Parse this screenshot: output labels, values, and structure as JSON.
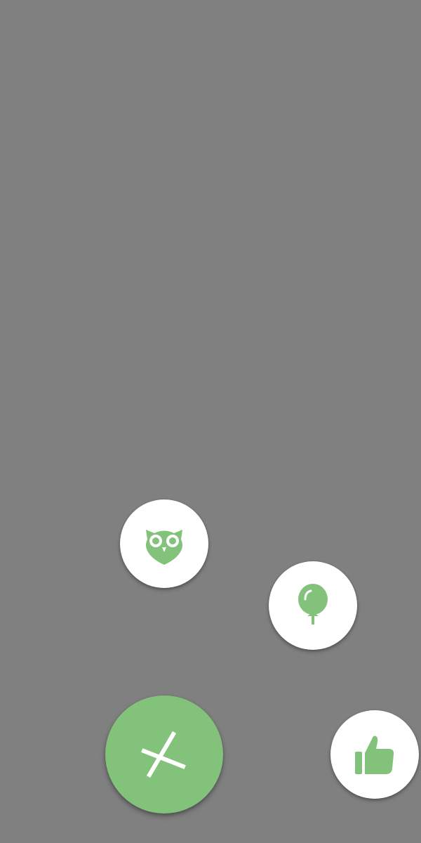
{
  "colors": {
    "background": "#808080",
    "accent": "#83c27a",
    "item_background": "#ffffff",
    "main_icon": "#ffffff"
  },
  "fab_menu": {
    "state": "expanded",
    "main_button": {
      "icon": "close-icon"
    },
    "items": [
      {
        "icon": "owl-icon"
      },
      {
        "icon": "balloon-icon"
      },
      {
        "icon": "thumbs-up-icon"
      }
    ]
  }
}
